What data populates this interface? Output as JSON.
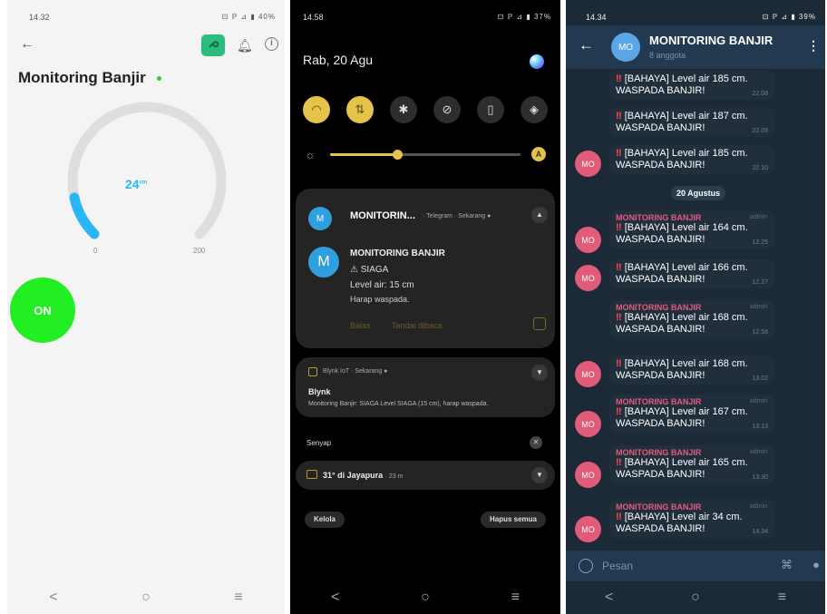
{
  "blynk": {
    "status_time": "14.32",
    "status_icons": "⊡ ℙ ⊿ ▮ 40%",
    "back": "←",
    "title": "Monitoring Banjir",
    "gauge_value": "24",
    "gauge_unit": "cm",
    "gauge_level": 0.12,
    "gauge_min": "0",
    "gauge_max": "200",
    "switch_label": "ON",
    "nav": [
      "<",
      "○",
      "≡"
    ]
  },
  "notif_shade": {
    "status_time": "14.58",
    "status_icons": "⊡ ℙ ⊿ ▮ 37%",
    "date": "Rab, 20 Agu",
    "brightness": 0.35,
    "auto_label": "A",
    "telegram_card": {
      "avatar_small": "M",
      "header": "MONITORIN...",
      "meta": "· Telegram · Sekarang ●",
      "avatar": "M",
      "sender": "MONITORING BANJIR",
      "line1": "⚠ SIAGA",
      "line2": "Level air: 15 cm",
      "line3": "Harap waspada.",
      "action1": "Balas",
      "action2": "Tandai dibaca"
    },
    "blynk_card": {
      "meta": "Blynk IoT · Sekarang ●",
      "title": "Blynk",
      "text": "Monitoring Banjir: SIAGA Level SIAGA (15 cm), harap waspada."
    },
    "silent_label": "Senyap",
    "weather_card": {
      "title": "31° di Jayapura",
      "meta": "· 23 m"
    },
    "manage_label": "Kelola",
    "clear_label": "Hapus semua",
    "nav": [
      "<",
      "○",
      "≡"
    ]
  },
  "telegram": {
    "status_time": "14.34",
    "status_icons": "⊡ ℙ ⊿ ▮ 39%",
    "avatar": "MO",
    "group_name": "MONITORING BANJIR",
    "members": "8 anggota",
    "date_chip": "20 Agustus",
    "messages": [
      {
        "sender": "",
        "admin": "",
        "line1": "[BAHAYA] Level air 185 cm.",
        "line2": "WASPADA BANJIR!",
        "time": "22.08"
      },
      {
        "sender": "",
        "admin": "",
        "line1": "[BAHAYA] Level air 187 cm.",
        "line2": "WASPADA BANJIR!",
        "time": "22.09"
      },
      {
        "sender": "",
        "admin": "",
        "line1": "[BAHAYA] Level air 185 cm.",
        "line2": "WASPADA BANJIR!",
        "time": "22.10"
      },
      {
        "sender": "MONITORING BANJIR",
        "admin": "admin",
        "line1": "[BAHAYA] Level air 164 cm.",
        "line2": "WASPADA BANJIR!",
        "time": "12.25"
      },
      {
        "sender": "",
        "admin": "",
        "line1": "[BAHAYA] Level air 166 cm.",
        "line2": "WASPADA BANJIR!",
        "time": "12.27"
      },
      {
        "sender": "MONITORING BANJIR",
        "admin": "admin",
        "line1": "[BAHAYA] Level air 168 cm.",
        "line2": "WASPADA BANJIR!",
        "time": "12.58"
      },
      {
        "sender": "",
        "admin": "",
        "line1": "[BAHAYA] Level air 168 cm.",
        "line2": "WASPADA BANJIR!",
        "time": "13.02"
      },
      {
        "sender": "MONITORING BANJIR",
        "admin": "admin",
        "line1": "[BAHAYA] Level air 167 cm.",
        "line2": "WASPADA BANJIR!",
        "time": "13.13"
      },
      {
        "sender": "MONITORING BANJIR",
        "admin": "admin",
        "line1": "[BAHAYA] Level air 165 cm.",
        "line2": "WASPADA BANJIR!",
        "time": "13.30"
      },
      {
        "sender": "MONITORING BANJIR",
        "admin": "admin",
        "line1": "[BAHAYA] Level air 34 cm.",
        "line2": "WASPADA BANJIR!",
        "time": "14.34"
      }
    ],
    "input_placeholder": "Pesan",
    "nav": [
      "<",
      "○",
      "≡"
    ]
  },
  "colors": {
    "blynk_bg": "#f4f4f4",
    "gauge_fill": "#29b6f6",
    "switch_on": "#22ee22",
    "shade_accent": "#e5c24a",
    "telegram_bg": "#1b2a36",
    "sender_color": "#e35b7f"
  }
}
